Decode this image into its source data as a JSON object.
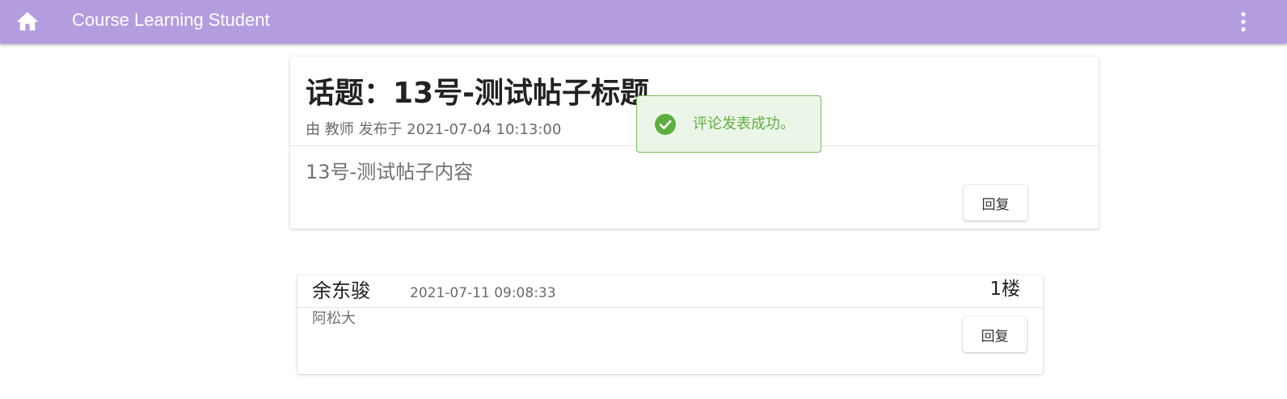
{
  "app": {
    "title": "Course Learning Student",
    "icons": {
      "home": "home-icon",
      "menu": "more-vert-icon"
    },
    "bar_color": "#b39ddf"
  },
  "topic": {
    "title": "话题：13号-测试帖子标题",
    "meta": "由 教师 发布于 2021-07-04 10:13:00",
    "content": "13号-测试帖子内容",
    "reply_label": "回复"
  },
  "comments": [
    {
      "author": "余东骏",
      "time": "2021-07-11 09:08:33",
      "floor": "1楼",
      "content": "阿松大",
      "reply_label": "回复"
    }
  ],
  "toast": {
    "icon": "check-circle-icon",
    "message": "评论发表成功。",
    "color": "#5fae40"
  }
}
